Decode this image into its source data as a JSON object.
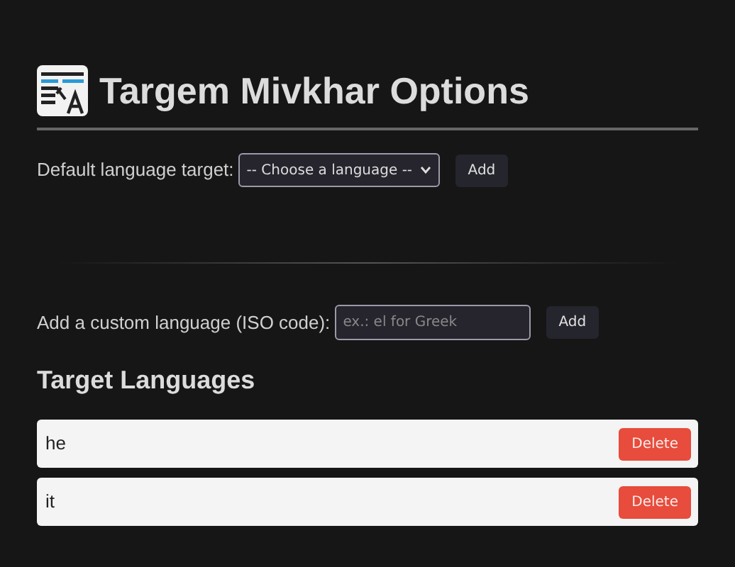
{
  "title": "Targem Mivkhar Options",
  "default_target": {
    "label": "Default language target:",
    "select_value": "-- Choose a language --",
    "button": "Add"
  },
  "custom_language": {
    "label": "Add a custom language (ISO code):",
    "placeholder": "ex.: el for Greek",
    "button": "Add"
  },
  "target_languages": {
    "heading": "Target Languages",
    "items": [
      {
        "code": "he",
        "button": "Delete"
      },
      {
        "code": "it",
        "button": "Delete"
      }
    ]
  }
}
